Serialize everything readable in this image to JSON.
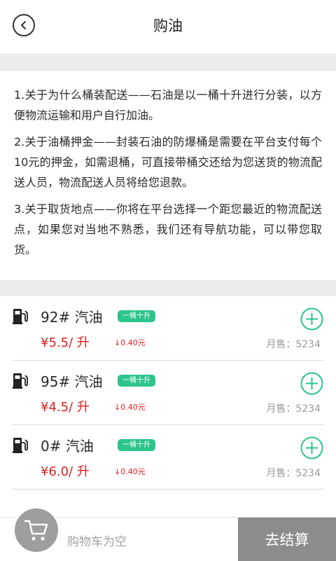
{
  "header": {
    "title": "购油"
  },
  "notes": [
    "1.关于为什么桶装配送——石油是以一桶十升进行分装，以方便物流运输和用户自行加油。",
    "2.关于油桶押金——封装石油的防爆桶是需要在平台支付每个10元的押金，如需退桶，可直接带桶交还给为您送货的物流配送人员，物流配送人员将给您退款。",
    "3.关于取货地点——你将在平台选择一个距您最近的物流配送点，如果您对当地不熟悉，我们还有导航功能，可以带您取货。"
  ],
  "products": [
    {
      "name": "92# 汽油",
      "tag": "一桶十升",
      "price": "¥5.5/ 升",
      "drop": "↓0.40元",
      "sales": "月售：5234"
    },
    {
      "name": "95# 汽油",
      "tag": "一桶十升",
      "price": "¥4.5/ 升",
      "drop": "↓0.40元",
      "sales": "月售：5234"
    },
    {
      "name": "0# 汽油",
      "tag": "一桶十升",
      "price": "¥6.0/ 升",
      "drop": "↓0.40元",
      "sales": "月售：5234"
    }
  ],
  "cart": {
    "empty_text": "购物车为空",
    "checkout_label": "去结算"
  },
  "colors": {
    "price": "#e02020",
    "tag_bg": "#2bc48a",
    "add_icon": "#2bc48a",
    "checkout_bg": "#8c8c8c"
  },
  "icons": {
    "back": "chevron-left-icon",
    "pump": "fuel-pump-icon",
    "add": "plus-circle-icon",
    "cart": "cart-icon"
  }
}
